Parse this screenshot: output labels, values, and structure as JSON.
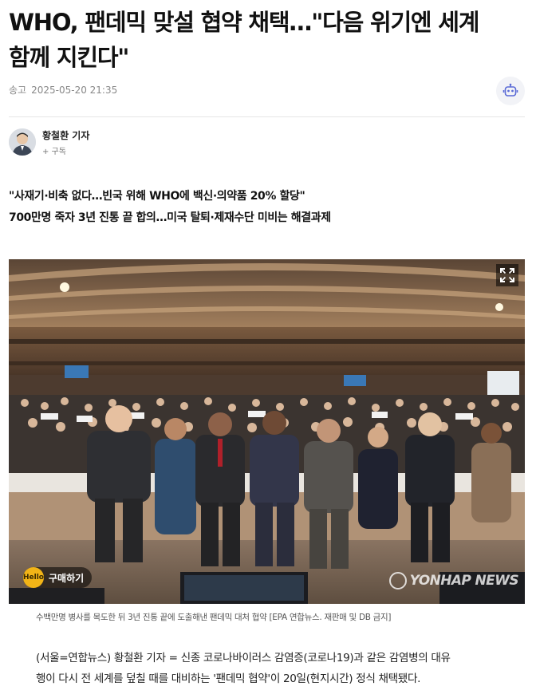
{
  "article": {
    "title_line1": "WHO, 팬데믹 맞설 협약 채택…\"다음 위기엔 세계",
    "title_line2": "함께 지킨다\"",
    "sent_label": "송고",
    "sent_time": "2025-05-20 21:35",
    "robot_icon": "robot-icon",
    "author": {
      "name": "황철환 기자",
      "subscribe": "+ 구독"
    },
    "subheadings": [
      "\"사재기·비축 없다…빈국 위해 WHO에 백신·의약품 20% 할당\"",
      "700만명 죽자 3년 진통 끝 합의…미국 탈퇴·제재수단 미비는 해결과제"
    ],
    "photo": {
      "buy_coin": "Hello",
      "buy_label": "구매하기",
      "watermark": "YONHAP NEWS",
      "expand_icon": "expand-icon",
      "caption": "수백만명 병사를 목도한 뒤 3년 진통 끝에 도출해낸 팬데믹 대처 협약 [EPA 연합뉴스. 재판매 및 DB 금지]"
    },
    "body_line1": "(서울=연합뉴스) 황철환 기자 = 신종 코로나바이러스 감염증(코로나19)과 같은 감염병의 대유",
    "body_line2": "행이 다시 전 세계를 덮칠 때를 대비하는 '팬데믹 협약'이 20일(현지시간) 정식 채택됐다."
  }
}
